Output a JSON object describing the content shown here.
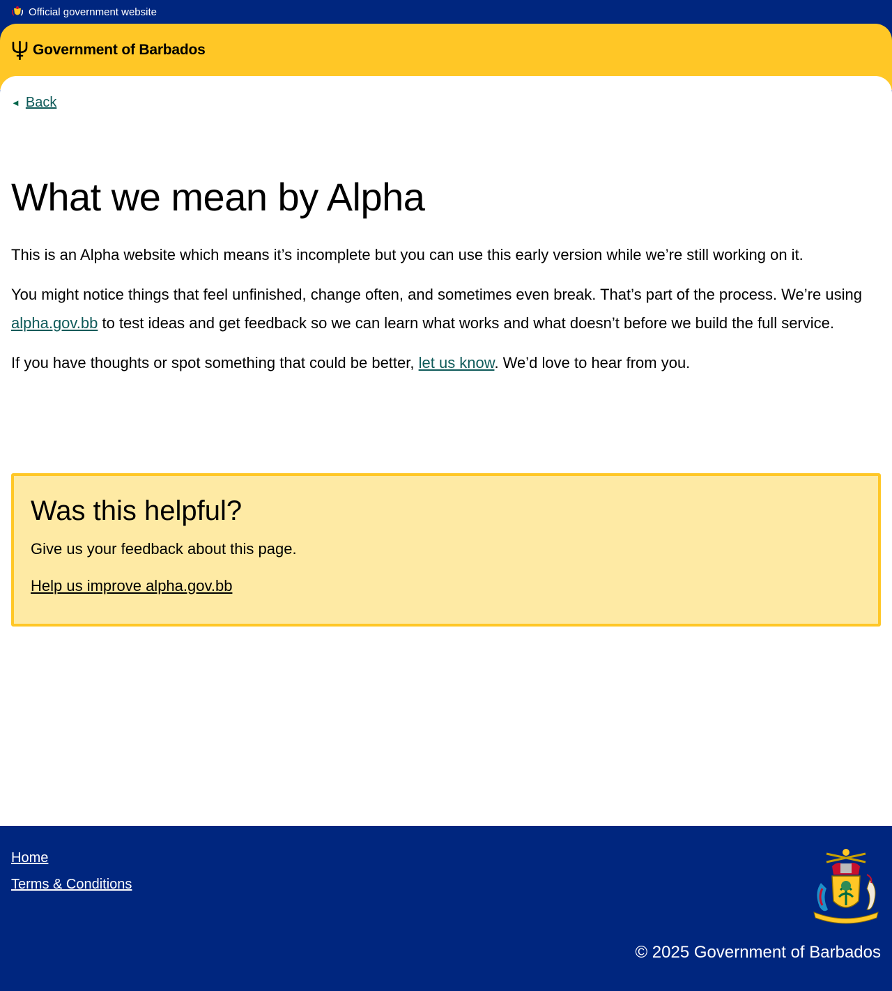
{
  "official_bar": {
    "text": "Official government website"
  },
  "header": {
    "brand": "Government of Barbados"
  },
  "nav": {
    "back_label": "Back"
  },
  "page": {
    "title": "What we mean by Alpha",
    "para1": "This is an Alpha website which means it’s incomplete but you can use this early version while we’re still working on it.",
    "para2_before": "You might notice things that feel unfinished, change often, and sometimes even break. That’s part of the process. We’re using ",
    "para2_link": "alpha.gov.bb",
    "para2_after": " to test ideas and get feedback so we can learn what works and what doesn’t before we build the full service.",
    "para3_before": "If you have thoughts or spot something that could be better, ",
    "para3_link": "let us know",
    "para3_after": ". We’d love to hear from you."
  },
  "feedback": {
    "title": "Was this helpful?",
    "text": "Give us your feedback about this page.",
    "link": "Help us improve alpha.gov.bb"
  },
  "footer": {
    "links": [
      "Home",
      "Terms & Conditions"
    ],
    "copyright": "© 2025 Government of Barbados"
  },
  "colors": {
    "navy": "#00267f",
    "gold": "#ffc726",
    "feedback_bg": "#feeaa4",
    "link": "#0e5a59"
  },
  "icons": {
    "official": "crest-icon",
    "brand": "trident-icon",
    "back": "arrow-left-icon",
    "footer": "coat-of-arms-icon"
  }
}
